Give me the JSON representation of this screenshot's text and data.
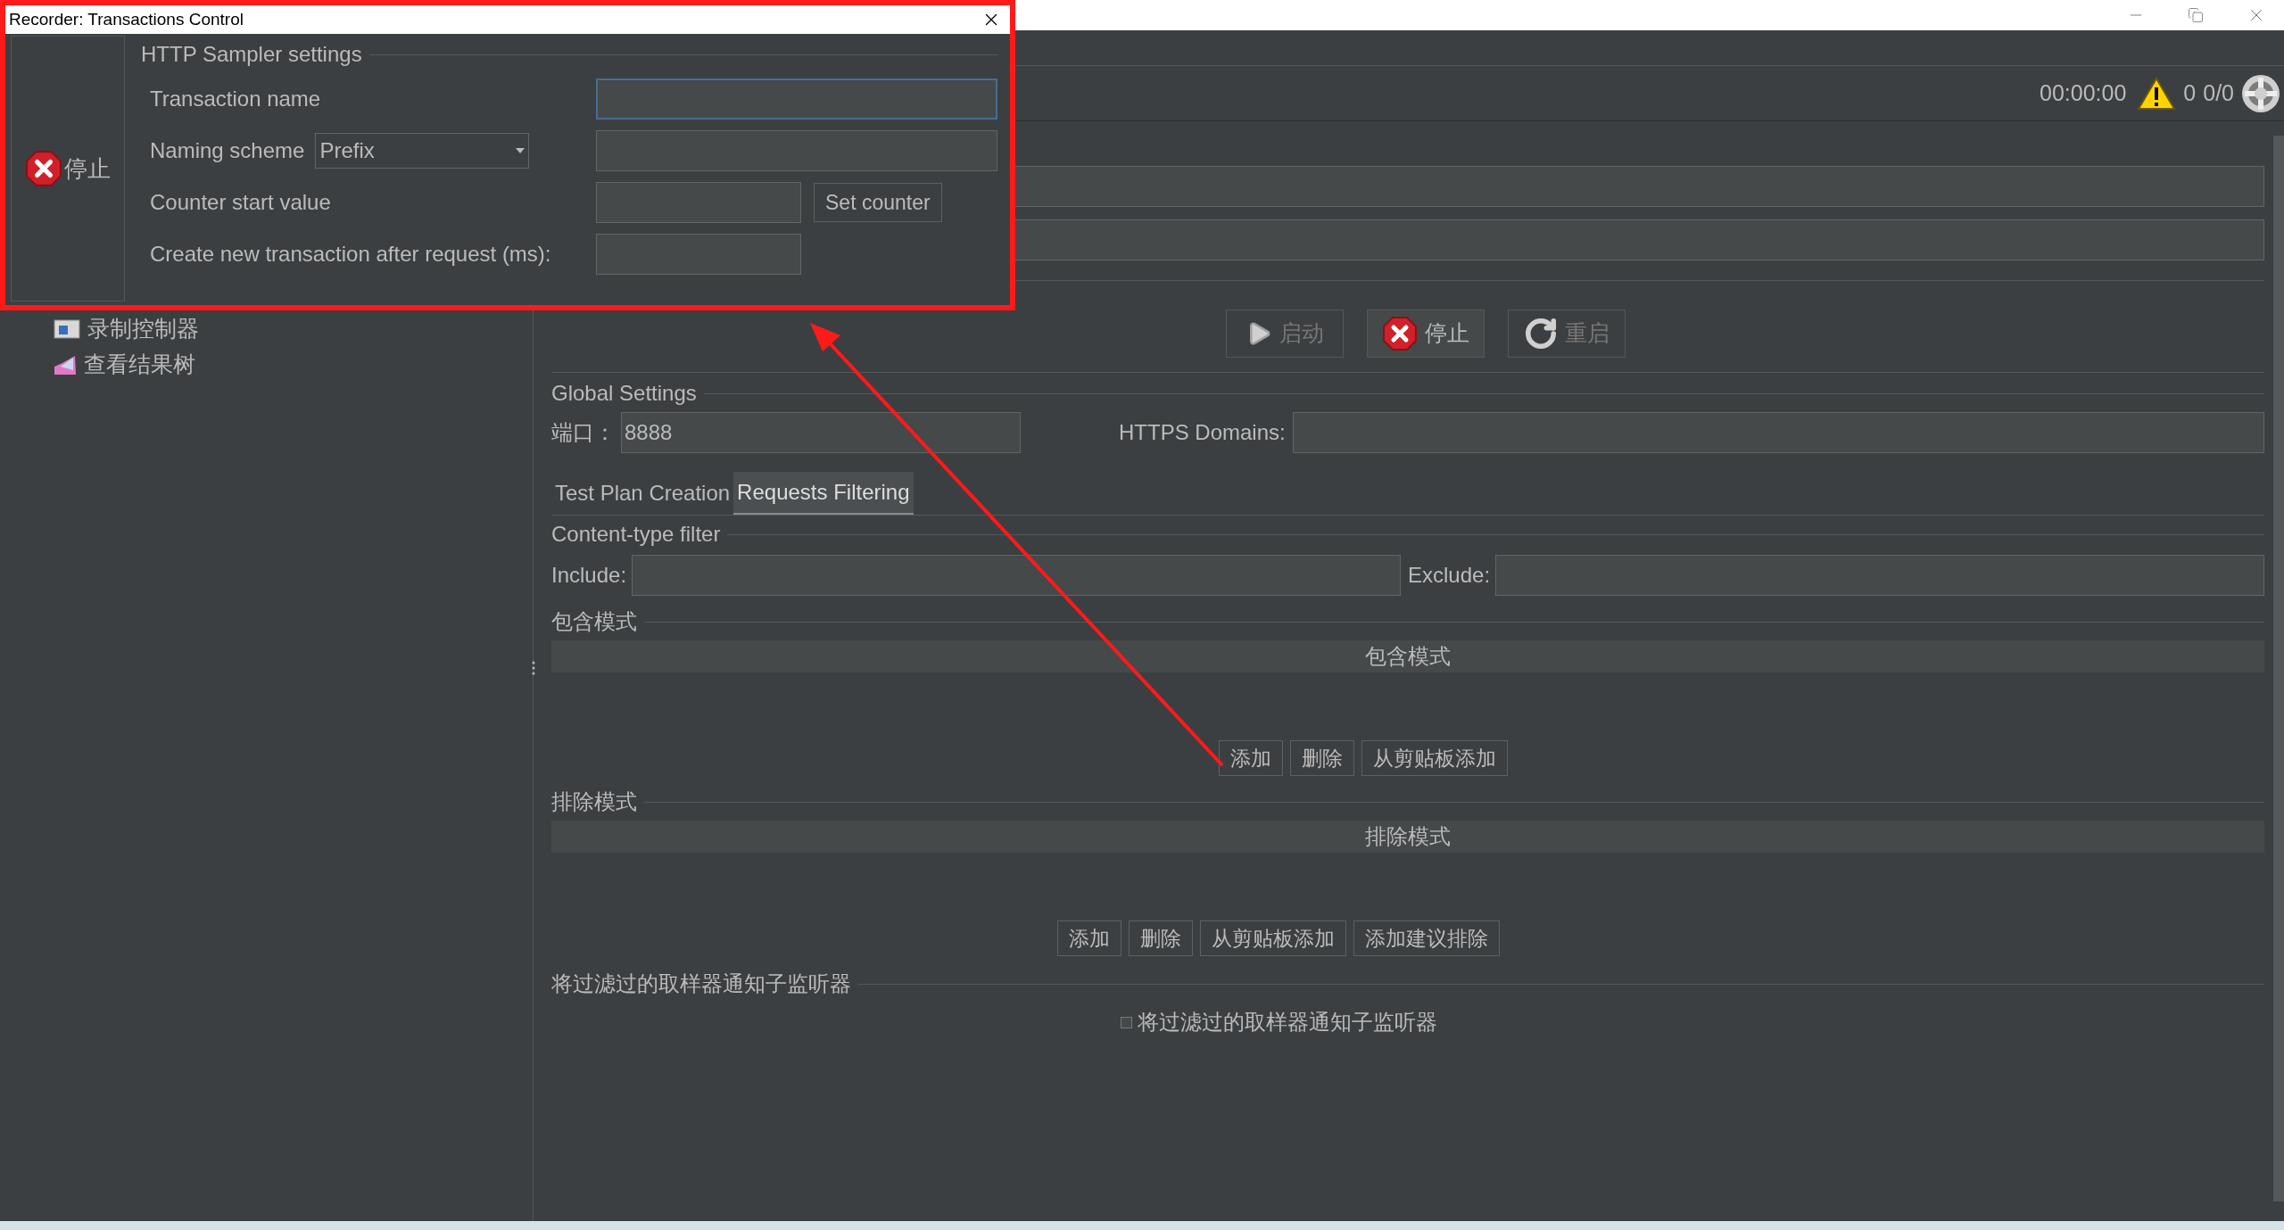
{
  "dialog": {
    "title": "Recorder: Transactions Control",
    "stop_button": {
      "label": "停止"
    },
    "legend": "HTTP Sampler settings",
    "rows": [
      {
        "kind": "text",
        "label": "Transaction name",
        "focused": true
      },
      {
        "kind": "select",
        "label": "Naming scheme",
        "value": "Prefix"
      },
      {
        "kind": "counter",
        "label": "Counter start value",
        "button": "Set counter"
      },
      {
        "kind": "short",
        "label": "Create new transaction after request (ms):"
      }
    ]
  },
  "toolbar": {
    "timer": "00:00:00",
    "error_count": "0",
    "thread_count": "0/0"
  },
  "tree": {
    "items": [
      {
        "label": "录制控制器",
        "kind": "recorder"
      },
      {
        "label": "查看结果树",
        "kind": "listener"
      }
    ]
  },
  "recorder": {
    "buttons": [
      {
        "kind": "start",
        "label": "启动",
        "disabled": true
      },
      {
        "kind": "stop",
        "label": "停止",
        "disabled": false
      },
      {
        "kind": "restart",
        "label": "重启",
        "disabled": true
      }
    ],
    "global_settings": {
      "legend": "Global Settings",
      "port_label": "端口：",
      "port_value": "8888",
      "https_label": "HTTPS Domains:"
    },
    "tabs": [
      {
        "label": "Test Plan Creation",
        "selected": false
      },
      {
        "label": "Requests Filtering",
        "selected": true
      }
    ],
    "content_type_filter": {
      "legend": "Content-type filter",
      "include_label": "Include:",
      "exclude_label": "Exclude:"
    },
    "include_patterns": {
      "legend": "包含模式",
      "column": "包含模式",
      "buttons": [
        "添加",
        "删除",
        "从剪贴板添加"
      ]
    },
    "exclude_patterns": {
      "legend": "排除模式",
      "column": "排除模式",
      "buttons": [
        "添加",
        "删除",
        "从剪贴板添加",
        "添加建议排除"
      ]
    },
    "notify": {
      "legend": "将过滤过的取样器通知子监听器",
      "checkbox": {
        "label": "将过滤过的取样器通知子监听器",
        "checked": false
      }
    }
  }
}
